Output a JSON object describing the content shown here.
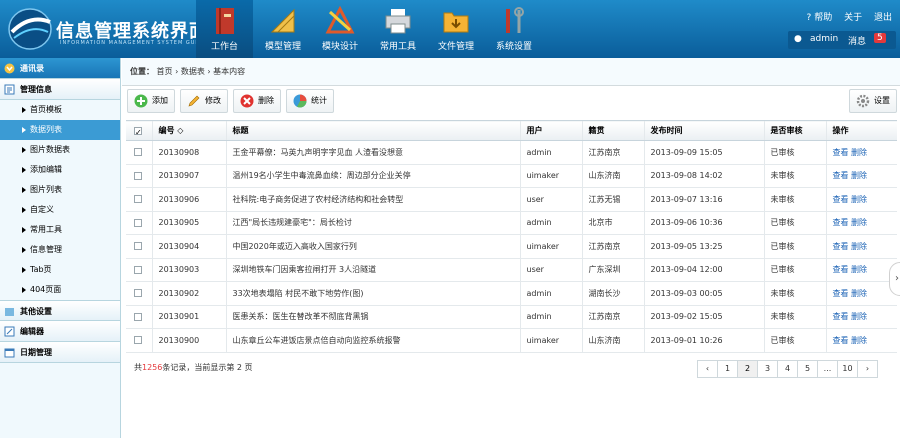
{
  "header": {
    "logo_title": "信息管理系统界面",
    "logo_subtitle": "INFORMATION MANAGEMENT SYSTEM GUI",
    "nav": [
      {
        "label": "工作台",
        "icon": "book-icon",
        "active": true
      },
      {
        "label": "模型管理",
        "icon": "ruler-icon",
        "active": false
      },
      {
        "label": "模块设计",
        "icon": "design-icon",
        "active": false
      },
      {
        "label": "常用工具",
        "icon": "printer-icon",
        "active": false
      },
      {
        "label": "文件管理",
        "icon": "folder-icon",
        "active": false
      },
      {
        "label": "系统设置",
        "icon": "tools-icon",
        "active": false
      }
    ],
    "help": "帮助",
    "about": "关于",
    "logout": "退出",
    "username": "admin",
    "messages_label": "消息",
    "messages_count": "5"
  },
  "sidebar": {
    "sections": [
      {
        "label": "通讯录",
        "icon": "contacts-icon",
        "active": true
      },
      {
        "label": "管理信息",
        "icon": "info-icon",
        "active": false
      }
    ],
    "items": [
      {
        "label": "首页模板",
        "active": false
      },
      {
        "label": "数据列表",
        "active": true
      },
      {
        "label": "图片数据表",
        "active": false
      },
      {
        "label": "添加编辑",
        "active": false
      },
      {
        "label": "图片列表",
        "active": false
      },
      {
        "label": "自定义",
        "active": false
      },
      {
        "label": "常用工具",
        "active": false
      },
      {
        "label": "信息管理",
        "active": false
      },
      {
        "label": "Tab页",
        "active": false
      },
      {
        "label": "404页面",
        "active": false
      }
    ],
    "bottom_sections": [
      {
        "label": "其他设置",
        "icon": "settings-folder-icon"
      },
      {
        "label": "编辑器",
        "icon": "editor-icon"
      },
      {
        "label": "日期管理",
        "icon": "calendar-icon"
      }
    ]
  },
  "breadcrumb": {
    "prefix": "位置：",
    "items": [
      "首页",
      "数据表",
      "基本内容"
    ]
  },
  "toolbar": {
    "add": "添加",
    "edit": "修改",
    "delete": "删除",
    "stats": "统计",
    "settings": "设置"
  },
  "table": {
    "headers": {
      "id": "编号",
      "title": "标题",
      "user": "用户",
      "region": "籍贯",
      "time": "发布时间",
      "audit": "是否审核",
      "action": "操作"
    },
    "view": "查看",
    "del": "删除",
    "rows": [
      {
        "id": "20130908",
        "title": "王金平幕僚：马英九声明字字见血 人渣看没想意",
        "user": "admin",
        "region": "江苏南京",
        "time": "2013-09-09 15:05",
        "audit": "已审核"
      },
      {
        "id": "20130907",
        "title": "温州19名小学生中毒流鼻血续：周边部分企业关停",
        "user": "uimaker",
        "region": "山东济南",
        "time": "2013-09-08 14:02",
        "audit": "未审核"
      },
      {
        "id": "20130906",
        "title": "社科院:电子商务促进了农村经济结构和社会转型",
        "user": "user",
        "region": "江苏无锡",
        "time": "2013-09-07 13:16",
        "audit": "未审核"
      },
      {
        "id": "20130905",
        "title": "江西\"局长违规建豪宅\"：局长检讨",
        "user": "admin",
        "region": "北京市",
        "time": "2013-09-06 10:36",
        "audit": "已审核"
      },
      {
        "id": "20130904",
        "title": "中国2020年或迈入高收入国家行列",
        "user": "uimaker",
        "region": "江苏南京",
        "time": "2013-09-05 13:25",
        "audit": "已审核"
      },
      {
        "id": "20130903",
        "title": "深圳地铁车门因乘客拉闸打开 3人沿隧道",
        "user": "user",
        "region": "广东深圳",
        "time": "2013-09-04 12:00",
        "audit": "已审核"
      },
      {
        "id": "20130902",
        "title": "33次地表塌陷 村民不敢下地劳作(图)",
        "user": "admin",
        "region": "湖南长沙",
        "time": "2013-09-03 00:05",
        "audit": "未审核"
      },
      {
        "id": "20130901",
        "title": "医患关系：医生在替改革不彻底背黑锅",
        "user": "admin",
        "region": "江苏南京",
        "time": "2013-09-02 15:05",
        "audit": "未审核"
      },
      {
        "id": "20130900",
        "title": "山东章丘公车进饭店景点倍自动向监控系统报警",
        "user": "uimaker",
        "region": "山东济南",
        "time": "2013-09-01 10:26",
        "audit": "已审核"
      }
    ]
  },
  "footer": {
    "pre": "共",
    "total": "1256",
    "mid": "条记录，当前显示第 ",
    "page": "2",
    "post": " 页"
  },
  "pager": {
    "prev": "‹",
    "pages": [
      "1",
      "2",
      "3",
      "4",
      "5",
      "...",
      "10"
    ],
    "current": "2",
    "next": "›"
  }
}
